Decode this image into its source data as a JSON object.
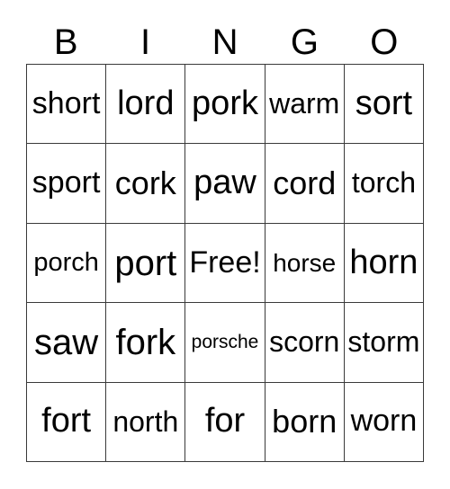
{
  "card": {
    "title": "BINGO",
    "free_space_label": "Free!",
    "grid_line_color": "#3a3a3a",
    "background_color": "#ffffff",
    "text_color": "#000000",
    "columns": 5,
    "rows": 5
  },
  "header": {
    "letters": [
      "B",
      "I",
      "N",
      "G",
      "O"
    ]
  },
  "grid": {
    "rows": [
      {
        "cells": [
          {
            "text": "short",
            "size": "34px",
            "free": false
          },
          {
            "text": "lord",
            "size": "38px",
            "free": false
          },
          {
            "text": "pork",
            "size": "38px",
            "free": false
          },
          {
            "text": "warm",
            "size": "32px",
            "free": false
          },
          {
            "text": "sort",
            "size": "38px",
            "free": false
          }
        ]
      },
      {
        "cells": [
          {
            "text": "sport",
            "size": "34px",
            "free": false
          },
          {
            "text": "cork",
            "size": "36px",
            "free": false
          },
          {
            "text": "paw",
            "size": "38px",
            "free": false
          },
          {
            "text": "cord",
            "size": "36px",
            "free": false
          },
          {
            "text": "torch",
            "size": "32px",
            "free": false
          }
        ]
      },
      {
        "cells": [
          {
            "text": "porch",
            "size": "29px",
            "free": false
          },
          {
            "text": "port",
            "size": "40px",
            "free": false
          },
          {
            "text": "Free!",
            "size": "34px",
            "free": true
          },
          {
            "text": "horse",
            "size": "28px",
            "free": false
          },
          {
            "text": "horn",
            "size": "38px",
            "free": false
          }
        ]
      },
      {
        "cells": [
          {
            "text": "saw",
            "size": "40px",
            "free": false
          },
          {
            "text": "fork",
            "size": "40px",
            "free": false
          },
          {
            "text": "porsche",
            "size": "21px",
            "free": false
          },
          {
            "text": "scorn",
            "size": "32px",
            "free": false
          },
          {
            "text": "storm",
            "size": "32px",
            "free": false
          }
        ]
      },
      {
        "cells": [
          {
            "text": "fort",
            "size": "38px",
            "free": false
          },
          {
            "text": "north",
            "size": "32px",
            "free": false
          },
          {
            "text": "for",
            "size": "38px",
            "free": false
          },
          {
            "text": "born",
            "size": "36px",
            "free": false
          },
          {
            "text": "worn",
            "size": "34px",
            "free": false
          }
        ]
      }
    ]
  }
}
